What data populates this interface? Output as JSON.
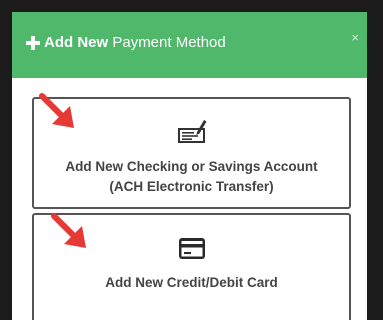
{
  "header": {
    "title_strong": "Add New",
    "title_light": "Payment Method",
    "close_symbol": "×",
    "background": "#4fb86a"
  },
  "options": [
    {
      "icon": "check-icon",
      "line1": "Add New Checking or Savings Account",
      "line2": "(ACH Electronic Transfer)"
    },
    {
      "icon": "credit-card-icon",
      "line1": "Add New Credit/Debit Card"
    }
  ],
  "annotation_color": "#e53935"
}
